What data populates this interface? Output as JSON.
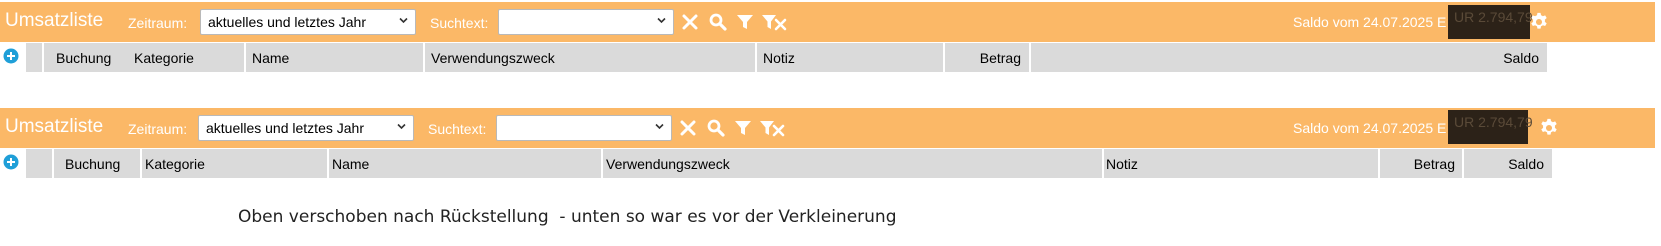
{
  "toolbar": {
    "title": "Umsatzliste",
    "zeitraum_label": "Zeitraum:",
    "zeitraum_value": "aktuelles und letztes Jahr",
    "suchtext_label": "Suchtext:",
    "suchtext_value": "",
    "saldo_text": "Saldo vom 24.07.2025 E",
    "saldo_redacted": "UR 2.794,79"
  },
  "columns": {
    "buchung": "Buchung",
    "kategorie": "Kategorie",
    "name": "Name",
    "verwendungszweck": "Verwendungszweck",
    "notiz": "Notiz",
    "betrag": "Betrag",
    "saldo": "Saldo"
  },
  "caption": "Oben verschoben nach Rückstellung  - unten so war es vor der Verkleinerung",
  "colors": {
    "toolbar_bg": "#fbb867",
    "header_bg": "#dadada",
    "add_icon": "#1f9fd8",
    "redaction": "#2c2218"
  },
  "icons": [
    "chevron-down-icon",
    "clear-x-icon",
    "search-icon",
    "filter-icon",
    "clear-filter-icon",
    "gear-icon",
    "add-circle-icon",
    "sort-indicator-icon"
  ]
}
